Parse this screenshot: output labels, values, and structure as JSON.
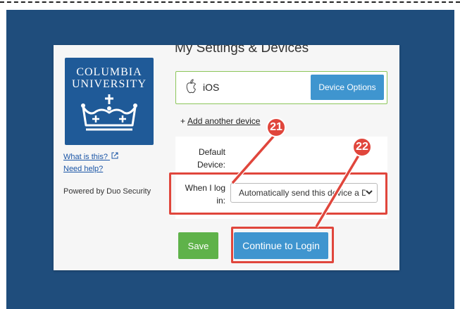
{
  "logo": {
    "line1": "COLUMBIA",
    "line2": "UNIVERSITY"
  },
  "sidebar": {
    "what_is_this": "What is this?",
    "need_help": "Need help?",
    "powered_by": "Powered by Duo Security"
  },
  "main": {
    "title": "My Settings & Devices",
    "device": {
      "name": "iOS",
      "options_label": "Device Options",
      "icon": "apple-icon"
    },
    "add_device_plus": "+",
    "add_device_label": "Add another device",
    "default_device_label_1": "Default",
    "default_device_label_2": "Device:",
    "when_login_label_1": "When I log",
    "when_login_label_2": "in:",
    "when_login_value": "Automatically send this device a Duo Push",
    "save_label": "Save",
    "continue_label": "Continue to Login"
  },
  "annotations": {
    "badge_1": "21",
    "badge_2": "22"
  },
  "colors": {
    "background": "#1f4d7c",
    "logo": "#1f5a98",
    "primary_button": "#3f95cf",
    "save_button": "#5fb24a",
    "highlight": "#e0463c",
    "device_border": "#8cc65a"
  }
}
